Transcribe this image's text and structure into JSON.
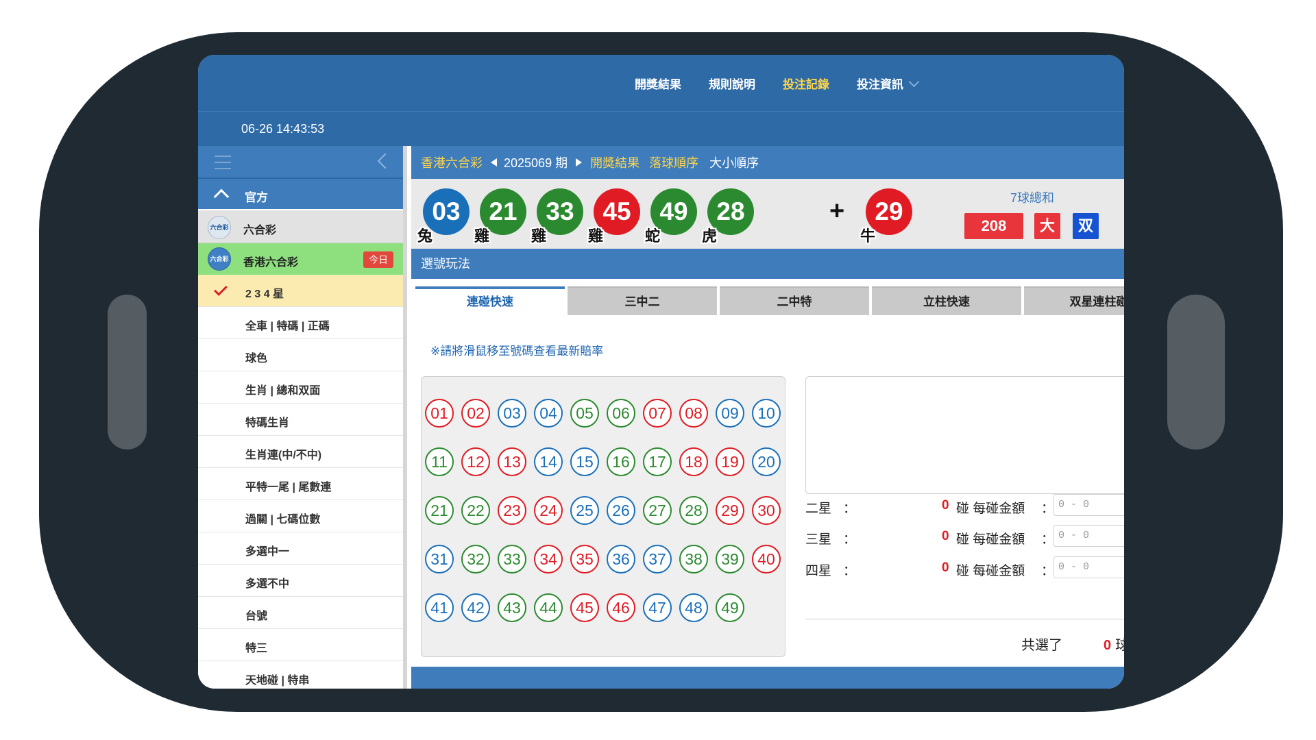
{
  "nav": {
    "items": [
      {
        "label": "開獎結果",
        "active": false
      },
      {
        "label": "規則說明",
        "active": false
      },
      {
        "label": "投注記錄",
        "active": true
      },
      {
        "label": "投注資訊",
        "active": false
      }
    ]
  },
  "datetime": "06-26 14:43:53",
  "sidebar": {
    "official_label": "官方",
    "group": {
      "label": "六合彩",
      "logo_text": "六合彩"
    },
    "lottery": {
      "label": "香港六合彩",
      "logo_text": "六合彩",
      "badge": "今日"
    },
    "items": [
      {
        "label": "2 3 4 星",
        "selected": true
      },
      {
        "label": "全車 | 特碼 | 正碼"
      },
      {
        "label": "球色"
      },
      {
        "label": "生肖 | 總和双面"
      },
      {
        "label": "特碼生肖"
      },
      {
        "label": "生肖連(中/不中)"
      },
      {
        "label": "平特一尾 | 尾數連"
      },
      {
        "label": "過關 | 七碼位數"
      },
      {
        "label": "多選中一"
      },
      {
        "label": "多選不中"
      },
      {
        "label": "台號"
      },
      {
        "label": "特三"
      },
      {
        "label": "天地碰 | 特串"
      }
    ]
  },
  "breadcrumb": {
    "lottery": "香港六合彩",
    "period": "2025069 期",
    "results_link": "開獎結果",
    "tab_drop_order": "落球順序",
    "tab_size_order": "大小順序"
  },
  "draw": {
    "balls": [
      {
        "num": "03",
        "zodiac": "兔",
        "color": "blue"
      },
      {
        "num": "21",
        "zodiac": "雞",
        "color": "green"
      },
      {
        "num": "33",
        "zodiac": "雞",
        "color": "green"
      },
      {
        "num": "45",
        "zodiac": "雞",
        "color": "red"
      },
      {
        "num": "49",
        "zodiac": "蛇",
        "color": "green"
      },
      {
        "num": "28",
        "zodiac": "虎",
        "color": "green"
      }
    ],
    "plus": "+",
    "special": {
      "num": "29",
      "zodiac": "牛",
      "color": "red"
    },
    "sum_title": "7球總和",
    "sum_value": "208",
    "sum_big": "大",
    "sum_even": "双"
  },
  "section_title": "選號玩法",
  "tabs": [
    {
      "label": "連碰快速",
      "active": true
    },
    {
      "label": "三中二"
    },
    {
      "label": "二中特"
    },
    {
      "label": "立柱快速"
    },
    {
      "label": "双星連柱碰"
    }
  ],
  "hint": "※請將滑鼠移至號碼查看最新賠率",
  "numbers": [
    {
      "n": "01",
      "c": "red"
    },
    {
      "n": "02",
      "c": "red"
    },
    {
      "n": "03",
      "c": "blue"
    },
    {
      "n": "04",
      "c": "blue"
    },
    {
      "n": "05",
      "c": "green"
    },
    {
      "n": "06",
      "c": "green"
    },
    {
      "n": "07",
      "c": "red"
    },
    {
      "n": "08",
      "c": "red"
    },
    {
      "n": "09",
      "c": "blue"
    },
    {
      "n": "10",
      "c": "blue"
    },
    {
      "n": "11",
      "c": "green"
    },
    {
      "n": "12",
      "c": "red"
    },
    {
      "n": "13",
      "c": "red"
    },
    {
      "n": "14",
      "c": "blue"
    },
    {
      "n": "15",
      "c": "blue"
    },
    {
      "n": "16",
      "c": "green"
    },
    {
      "n": "17",
      "c": "green"
    },
    {
      "n": "18",
      "c": "red"
    },
    {
      "n": "19",
      "c": "red"
    },
    {
      "n": "20",
      "c": "blue"
    },
    {
      "n": "21",
      "c": "green"
    },
    {
      "n": "22",
      "c": "green"
    },
    {
      "n": "23",
      "c": "red"
    },
    {
      "n": "24",
      "c": "red"
    },
    {
      "n": "25",
      "c": "blue"
    },
    {
      "n": "26",
      "c": "blue"
    },
    {
      "n": "27",
      "c": "green"
    },
    {
      "n": "28",
      "c": "green"
    },
    {
      "n": "29",
      "c": "red"
    },
    {
      "n": "30",
      "c": "red"
    },
    {
      "n": "31",
      "c": "blue"
    },
    {
      "n": "32",
      "c": "green"
    },
    {
      "n": "33",
      "c": "green"
    },
    {
      "n": "34",
      "c": "red"
    },
    {
      "n": "35",
      "c": "red"
    },
    {
      "n": "36",
      "c": "blue"
    },
    {
      "n": "37",
      "c": "blue"
    },
    {
      "n": "38",
      "c": "green"
    },
    {
      "n": "39",
      "c": "green"
    },
    {
      "n": "40",
      "c": "red"
    },
    {
      "n": "41",
      "c": "blue"
    },
    {
      "n": "42",
      "c": "blue"
    },
    {
      "n": "43",
      "c": "green"
    },
    {
      "n": "44",
      "c": "green"
    },
    {
      "n": "45",
      "c": "red"
    },
    {
      "n": "46",
      "c": "red"
    },
    {
      "n": "47",
      "c": "blue"
    },
    {
      "n": "48",
      "c": "blue"
    },
    {
      "n": "49",
      "c": "green"
    }
  ],
  "stars": [
    {
      "label": "二星",
      "colon": "：",
      "count": "0",
      "unit": "碰",
      "amount_label": "每碰金額",
      "colon2": "：",
      "placeholder": "0 - 0"
    },
    {
      "label": "三星",
      "colon": "：",
      "count": "0",
      "unit": "碰",
      "amount_label": "每碰金額",
      "colon2": "：",
      "placeholder": "0 - 0"
    },
    {
      "label": "四星",
      "colon": "：",
      "count": "0",
      "unit": "碰",
      "amount_label": "每碰金額",
      "colon2": "：",
      "placeholder": "0 - 0"
    }
  ],
  "total": {
    "label": "共選了",
    "count": "0",
    "unit": "球"
  },
  "colors": {
    "red": "#e01b23",
    "blue": "#1a6fb9",
    "green": "#2b8a2f",
    "header": "#2e6aa5",
    "accent": "#ffd54a"
  }
}
